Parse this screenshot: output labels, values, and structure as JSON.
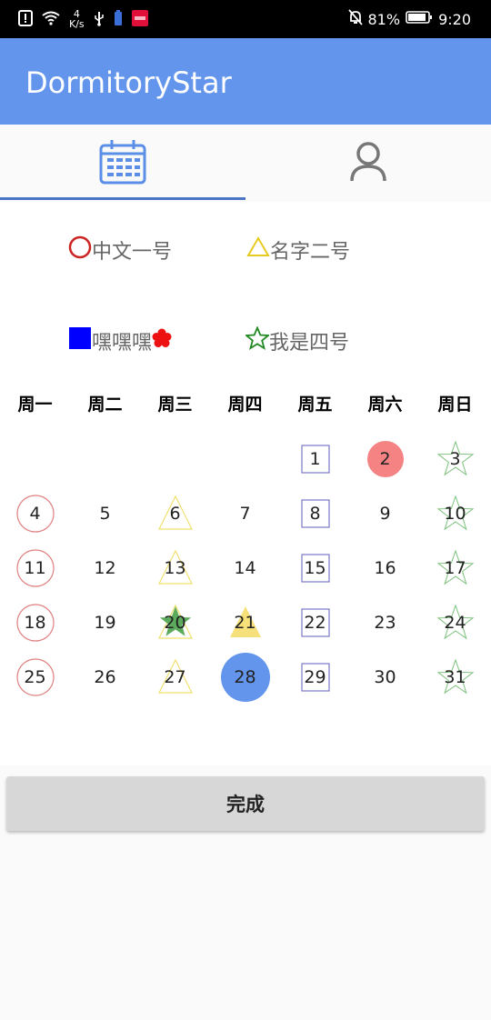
{
  "status_bar": {
    "net_speed": "4",
    "net_unit": "K/s",
    "battery": "81%",
    "time": "9:20",
    "alert_icon": "alert-icon",
    "wifi_icon": "wifi-icon",
    "usb_icon": "usb-icon",
    "mute_icon": "bell-off-icon",
    "battery_icon": "battery-icon"
  },
  "app": {
    "title": "DormitoryStar",
    "accent": "#6495ed"
  },
  "tabs": [
    {
      "icon": "calendar-icon",
      "selected": true
    },
    {
      "icon": "person-icon",
      "selected": false
    }
  ],
  "legend": [
    {
      "symbol": "circle",
      "color": "#cc2222",
      "label": "中文一号"
    },
    {
      "symbol": "triangle",
      "color": "#e6cc22",
      "label": "名字二号"
    },
    {
      "symbol": "square",
      "color": "#0000ff",
      "label": "嘿嘿嘿",
      "suffix_icon": "plum-blossom-icon"
    },
    {
      "symbol": "star",
      "color": "#228822",
      "label": "我是四号"
    }
  ],
  "calendar": {
    "weekdays": [
      "周一",
      "周二",
      "周三",
      "周四",
      "周五",
      "周六",
      "周日"
    ],
    "today": "28",
    "days": [
      {
        "day": "1",
        "marks": [
          "square"
        ]
      },
      {
        "day": "2",
        "marks": [
          "circle-filled"
        ]
      },
      {
        "day": "3",
        "marks": [
          "star"
        ]
      },
      {
        "day": "4",
        "marks": [
          "circle"
        ]
      },
      {
        "day": "5",
        "marks": []
      },
      {
        "day": "6",
        "marks": [
          "triangle"
        ]
      },
      {
        "day": "7",
        "marks": []
      },
      {
        "day": "8",
        "marks": [
          "square"
        ]
      },
      {
        "day": "9",
        "marks": []
      },
      {
        "day": "10",
        "marks": [
          "star"
        ]
      },
      {
        "day": "11",
        "marks": [
          "circle"
        ]
      },
      {
        "day": "12",
        "marks": []
      },
      {
        "day": "13",
        "marks": [
          "triangle"
        ]
      },
      {
        "day": "14",
        "marks": []
      },
      {
        "day": "15",
        "marks": [
          "square"
        ]
      },
      {
        "day": "16",
        "marks": []
      },
      {
        "day": "17",
        "marks": [
          "star"
        ]
      },
      {
        "day": "18",
        "marks": [
          "circle"
        ]
      },
      {
        "day": "19",
        "marks": []
      },
      {
        "day": "20",
        "marks": [
          "triangle",
          "star-filled"
        ]
      },
      {
        "day": "21",
        "marks": [
          "triangle-filled"
        ]
      },
      {
        "day": "22",
        "marks": [
          "square"
        ]
      },
      {
        "day": "23",
        "marks": []
      },
      {
        "day": "24",
        "marks": [
          "star"
        ]
      },
      {
        "day": "25",
        "marks": [
          "circle"
        ]
      },
      {
        "day": "26",
        "marks": []
      },
      {
        "day": "27",
        "marks": [
          "triangle"
        ]
      },
      {
        "day": "28",
        "marks": [
          "today"
        ]
      },
      {
        "day": "29",
        "marks": [
          "square"
        ]
      },
      {
        "day": "30",
        "marks": []
      },
      {
        "day": "31",
        "marks": [
          "star"
        ]
      }
    ]
  },
  "done_button": "完成"
}
